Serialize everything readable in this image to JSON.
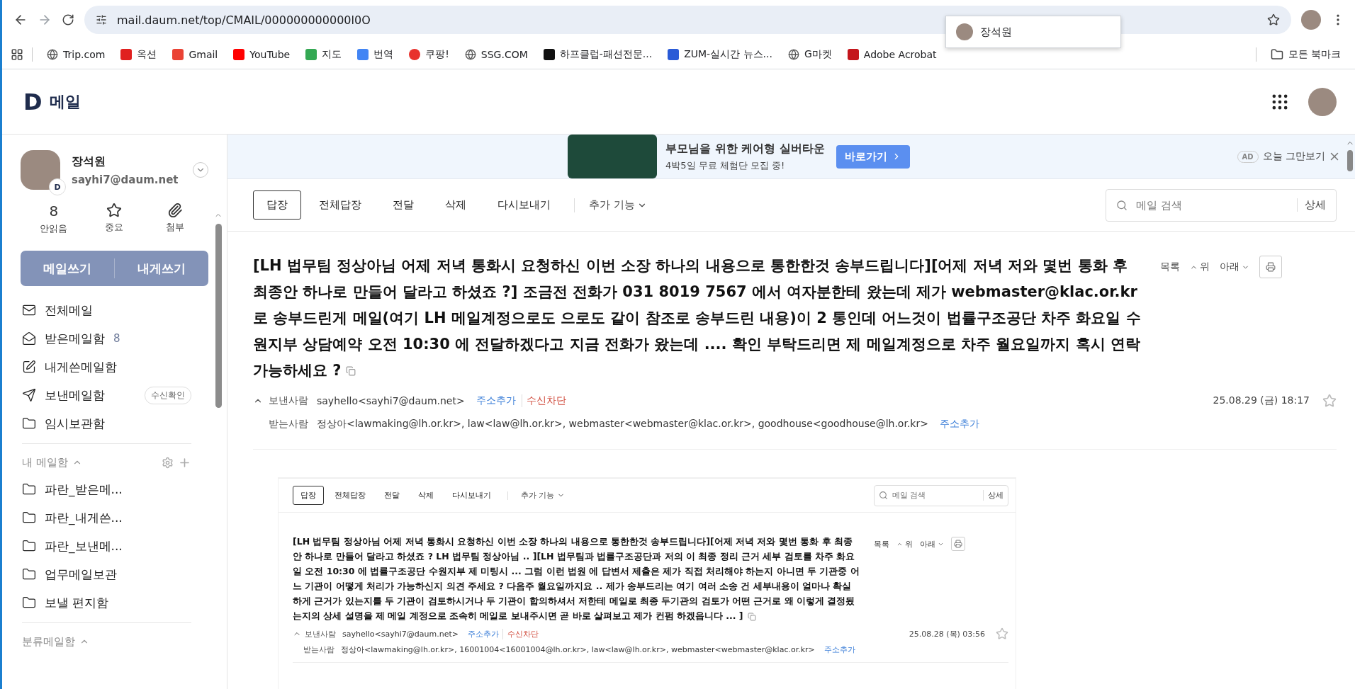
{
  "browser": {
    "url": "mail.daum.net/top/CMAIL/000000000000l0O",
    "profile_popup": {
      "name": "장석원"
    },
    "bookmarks": [
      {
        "label": "Trip.com",
        "kind": "globe"
      },
      {
        "label": "옥션",
        "kind": "square",
        "color": "#e0201f"
      },
      {
        "label": "Gmail",
        "kind": "square",
        "color": "#ea4335"
      },
      {
        "label": "YouTube",
        "kind": "square",
        "color": "#ff0000"
      },
      {
        "label": "지도",
        "kind": "square",
        "color": "#34a853"
      },
      {
        "label": "번역",
        "kind": "square",
        "color": "#4285f4"
      },
      {
        "label": "쿠팡!",
        "kind": "circle",
        "color": "#e8322d"
      },
      {
        "label": "SSG.COM",
        "kind": "globe"
      },
      {
        "label": "하프클럽-패션전문...",
        "kind": "square",
        "color": "#111111"
      },
      {
        "label": "ZUM-실시간 뉴스...",
        "kind": "square",
        "color": "#2a5bd7"
      },
      {
        "label": "G마켓",
        "kind": "globe"
      },
      {
        "label": "Adobe Acrobat",
        "kind": "square",
        "color": "#c4161c"
      }
    ],
    "all_bookmarks": "모든 북마크"
  },
  "header": {
    "logo": "D",
    "title": "메일"
  },
  "account": {
    "name": "장석원",
    "email": "sayhi7@daum.net",
    "badge": "D"
  },
  "stats": [
    {
      "kind": "count",
      "value": "8",
      "label": "안읽음"
    },
    {
      "kind": "star",
      "label": "중요"
    },
    {
      "kind": "clip",
      "label": "첨부"
    }
  ],
  "compose_buttons": [
    "메일쓰기",
    "내게쓰기"
  ],
  "mailboxes": [
    {
      "kind": "all",
      "label": "전체메일"
    },
    {
      "kind": "inbox",
      "label": "받은메일함",
      "count": "8"
    },
    {
      "kind": "self",
      "label": "내게쓴메일함"
    },
    {
      "kind": "sent",
      "label": "보낸메일함",
      "badge": "수신확인"
    },
    {
      "kind": "drafts",
      "label": "임시보관함"
    }
  ],
  "my_folders": {
    "title": "내 메일함",
    "expanded": true,
    "items": [
      "파란_받은메...",
      "파란_내게쓴...",
      "파란_보낸메...",
      "업무메일보관",
      "보낼 편지함"
    ]
  },
  "category_folders": {
    "title": "분류메일함",
    "expanded": true
  },
  "ad": {
    "headline": "부모님을 위한 케어형 실버타운",
    "sub": "4박5일 무료 체험단 모집 중!",
    "button": "바로가기",
    "tag": "AD",
    "dismiss": "오늘 그만보기"
  },
  "toolbar": {
    "actions": [
      {
        "label": "답장",
        "kind": "outlined"
      },
      {
        "label": "전체답장",
        "kind": "plain"
      },
      {
        "label": "전달",
        "kind": "plain"
      },
      {
        "label": "삭제",
        "kind": "plain"
      },
      {
        "label": "다시보내기",
        "kind": "plain"
      }
    ],
    "more": "추가 기능",
    "search_placeholder": "메일 검색",
    "detail": "상세"
  },
  "message": {
    "subject": "[LH 법무팀 정상아님 어제 저녁 통화시 요청하신 이번 소장 하나의 내용으로 통한한것 송부드립니다][어제 저녁 저와 몇번 통화 후 최종안 하나로 만들어 달라고 하셨죠 ?] 조금전 전화가 031 8019 7567 에서 여자분한테 왔는데 제가 webmaster@klac.or.kr 로 송부드린게 메일(여기 LH 메일계정으로도 으로도 같이 참조로 송부드린 내용)이 2 통인데 어느것이 법률구조공단 차주 화요일 수원지부 상담예약 오전 10:30 에 전달하겠다고 지금 전화가 왔는데 .... 확인 부탁드리면 제 메일계정으로 차주 월요일까지 혹시 연락 가능하세요 ?",
    "nav": [
      "목록",
      "위",
      "아래"
    ],
    "sender_label": "보낸사람",
    "sender": "sayhello<sayhi7@daum.net>",
    "add_address": "주소추가",
    "block": "수신차단",
    "date": "25.08.29 (금) 18:17",
    "starred": false,
    "recipient_label": "받는사람",
    "recipients": "정상아<lawmaking@lh.or.kr>, law<law@lh.or.kr>, webmaster<webmaster@klac.or.kr>, goodhouse<goodhouse@lh.or.kr>",
    "recipient_add": "주소추가"
  },
  "attached_screenshot": {
    "toolbar": {
      "actions": [
        {
          "label": "답장",
          "kind": "outlined"
        },
        {
          "label": "전체답장",
          "kind": "plain"
        },
        {
          "label": "전달",
          "kind": "plain"
        },
        {
          "label": "삭제",
          "kind": "plain"
        },
        {
          "label": "다시보내기",
          "kind": "plain"
        }
      ],
      "more": "추가 기능",
      "search_placeholder": "메일 검색",
      "detail": "상세"
    },
    "message": {
      "subject": "[LH 법무팀 정상아님 어제 저녁 통화시 요청하신 이번 소장 하나의 내용으로 통한한것 송부드립니다][어제 저녁 저와 몇번 통화 후 최종안 하나로 만들어 달라고 하셨죠 ? LH 법무팀 정상아님 .. ][LH 법무팀과 법률구조공단과 저의 이 최종 정리 근거 세부 검토를 차주 화요일 오전 10:30 에 법률구조공단 수원지부 제 미팅시 ... 그럼 이런 법원 에 답변서 제출은 제가 직접 처리해야 하는지 아니면 두 기관중 어느 기관이 어떻게 처리가 가능하신지 의견 주세요 ? 다음주 월요일까지요 .. 제가 송부드리는 여기 여러 소송 건 세부내용이 얼마나 확실하게 근거가 있는지를 두 기관이 검토하시거나 두 기관이 합의하셔서 저한테 메일로 최종 두기관의 검토가 어떤 근거로 왜 이렇게 결정됬는지의 상세 설명을 제 메일 계정으로 조속히 메일로 보내주시면 곧 바로 살펴보고 제가 컨펌 하겠읍니다 ... ]",
      "nav": [
        "목록",
        "위",
        "아래"
      ],
      "sender_label": "보낸사람",
      "sender": "sayhello<sayhi7@daum.net>",
      "add_address": "주소추가",
      "block": "수신차단",
      "date": "25.08.28 (목) 03:56",
      "starred": false,
      "recipient_label": "받는사람",
      "recipients": "정상아<lawmaking@lh.or.kr>, 16001004<16001004@lh.or.kr>, law<law@lh.or.kr>, webmaster<webmaster@klac.or.kr>",
      "recipient_add": "주소추가"
    }
  }
}
